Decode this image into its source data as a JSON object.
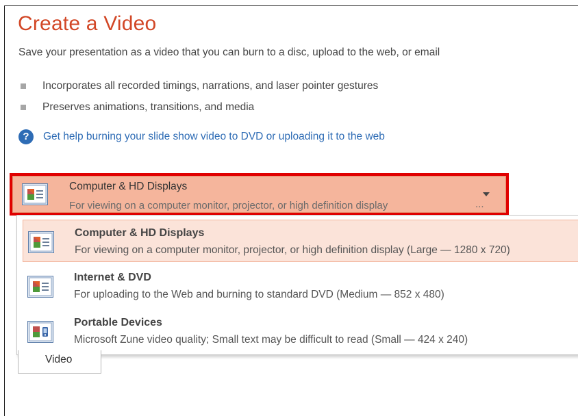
{
  "header": {
    "title": "Create a Video",
    "description": "Save your presentation as a video that you can burn to a disc, upload to the web, or email"
  },
  "bullets": [
    "Incorporates all recorded timings, narrations, and laser pointer gestures",
    "Preserves animations, transitions, and media"
  ],
  "help": {
    "icon": "question-icon",
    "link_text": "Get help burning your slide show video to DVD or uploading it to the web"
  },
  "quality_select": {
    "selected_title": "Computer & HD Displays",
    "selected_subtitle": "For viewing on a computer monitor, projector, or high definition display",
    "ellipsis": "...",
    "highlight_color": "#e00000"
  },
  "options": [
    {
      "title": "Computer & HD Displays",
      "subtitle": "For viewing on a computer monitor, projector, or high definition display  (Large — 1280 x 720)",
      "icon": "monitor-display-icon"
    },
    {
      "title": "Internet & DVD",
      "subtitle": "For uploading to the Web and burning to standard DVD  (Medium — 852 x 480)",
      "icon": "monitor-display-icon"
    },
    {
      "title": "Portable Devices",
      "subtitle": "Microsoft Zune video quality; Small text may be difficult to read  (Small — 424 x 240)",
      "icon": "portable-device-icon"
    }
  ],
  "create_button": {
    "label": "Video"
  },
  "colors": {
    "title": "#d24726",
    "link": "#2e6cb5",
    "selected_bg": "#f5b59c",
    "option_active_bg": "#fbe3d9"
  }
}
